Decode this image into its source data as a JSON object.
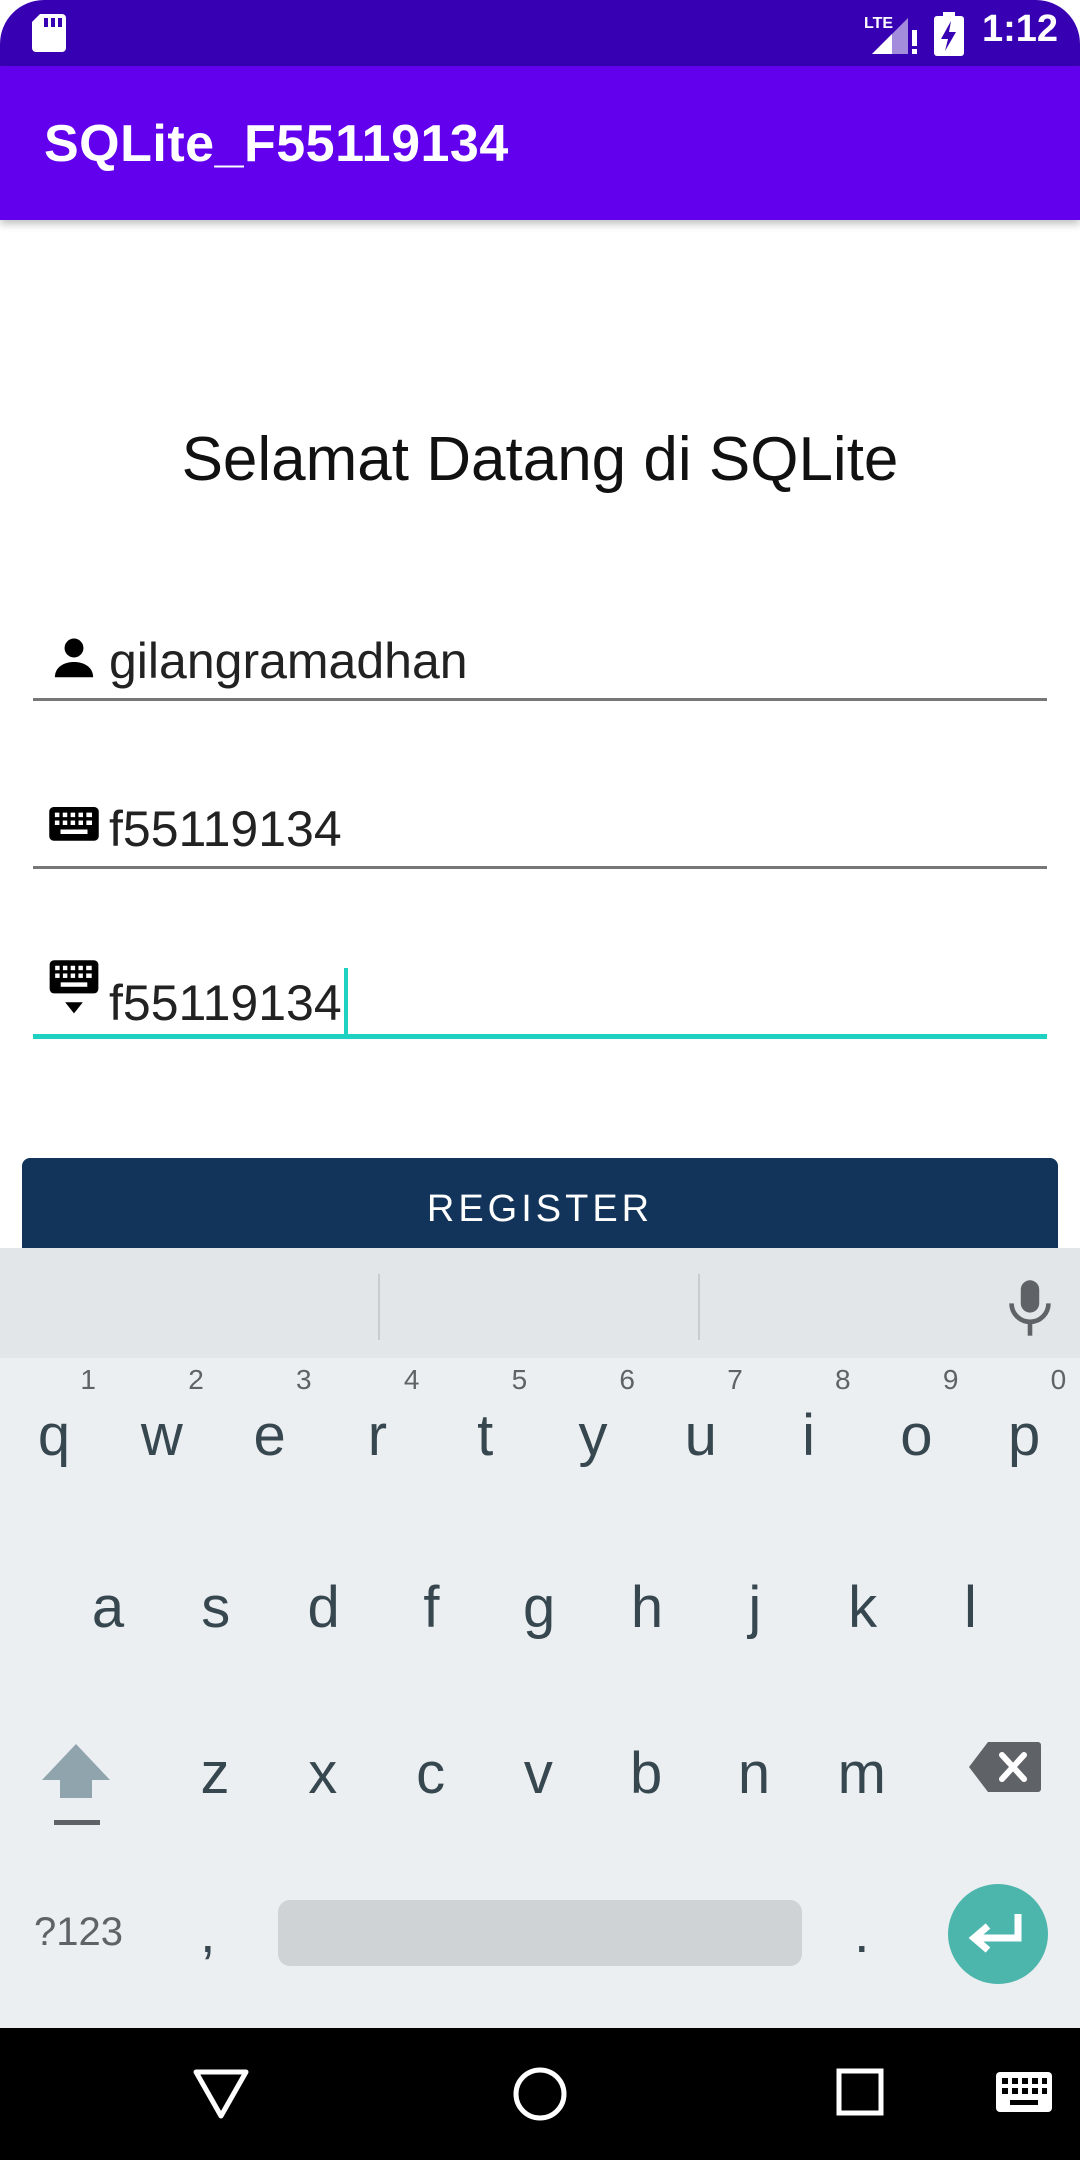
{
  "status_bar": {
    "time": "1:12",
    "network": "LTE"
  },
  "app_bar": {
    "title": "SQLite_F55119134"
  },
  "main": {
    "welcome": "Selamat Datang di SQLite",
    "username_value": "gilangramadhan",
    "password_value": "f55119134",
    "confirm_value": "f55119134",
    "register_label": "REGISTER"
  },
  "keyboard": {
    "row1": [
      {
        "k": "q",
        "n": "1"
      },
      {
        "k": "w",
        "n": "2"
      },
      {
        "k": "e",
        "n": "3"
      },
      {
        "k": "r",
        "n": "4"
      },
      {
        "k": "t",
        "n": "5"
      },
      {
        "k": "y",
        "n": "6"
      },
      {
        "k": "u",
        "n": "7"
      },
      {
        "k": "i",
        "n": "8"
      },
      {
        "k": "o",
        "n": "9"
      },
      {
        "k": "p",
        "n": "0"
      }
    ],
    "row2": [
      "a",
      "s",
      "d",
      "f",
      "g",
      "h",
      "j",
      "k",
      "l"
    ],
    "row3": [
      "z",
      "x",
      "c",
      "v",
      "b",
      "n",
      "m"
    ],
    "symbols_label": "?123",
    "comma": ",",
    "period": "."
  },
  "colors": {
    "status": "#3700b3",
    "appbar": "#6200ee",
    "accent": "#1fd1c1",
    "button": "#13345a",
    "enter": "#4db6ac"
  }
}
